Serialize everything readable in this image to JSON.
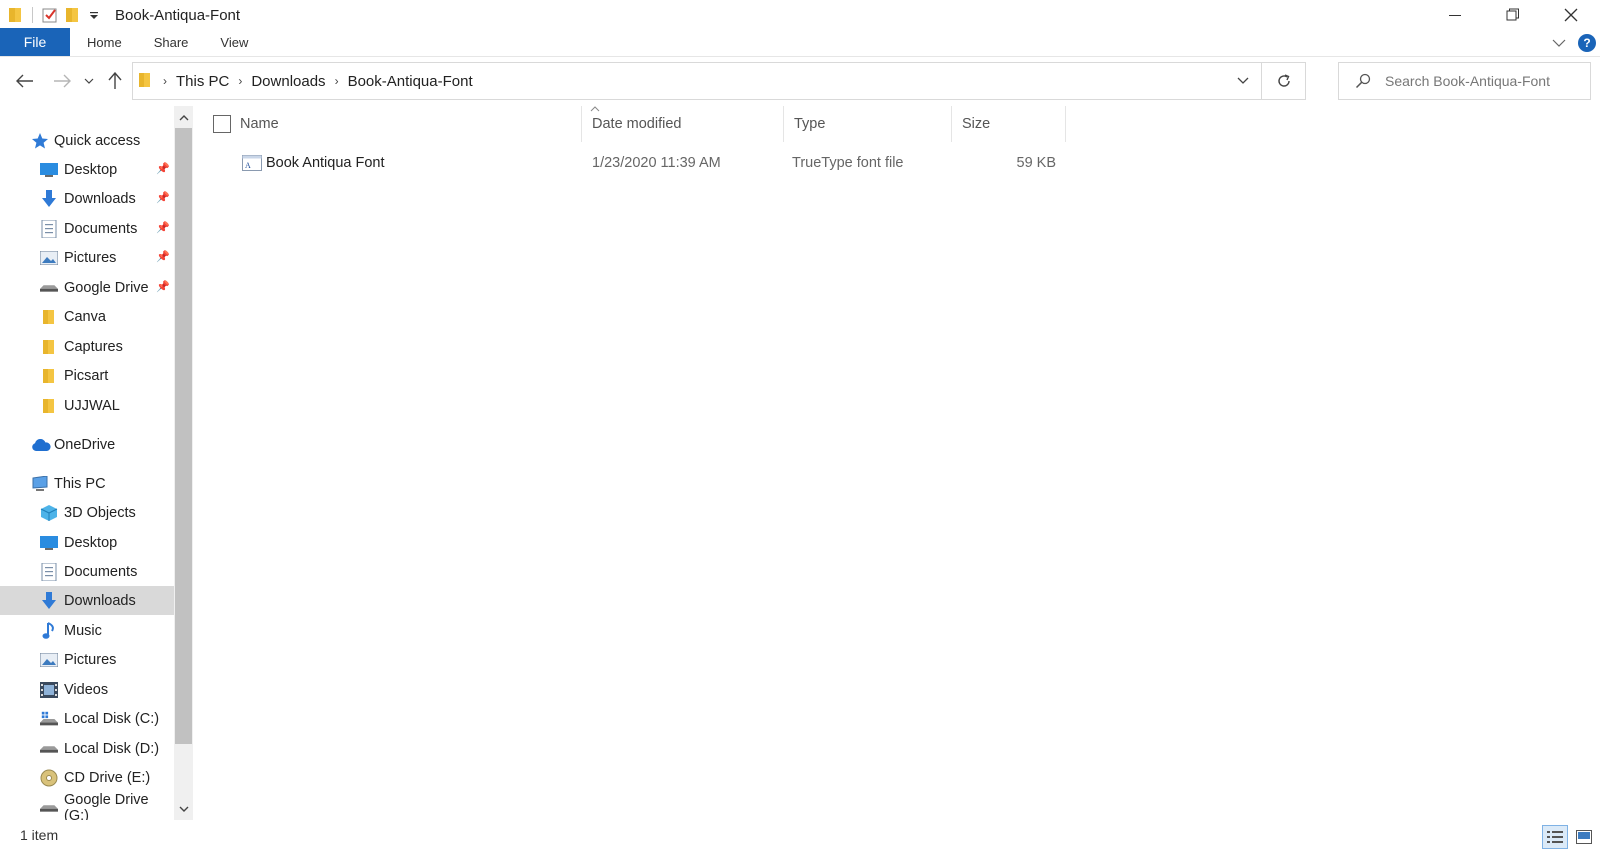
{
  "window": {
    "title": "Book-Antiqua-Font",
    "minimize_icon": "minimize-icon",
    "maximize_icon": "restore-icon",
    "close_icon": "close-icon"
  },
  "ribbon": {
    "tabs": [
      {
        "label": "File"
      },
      {
        "label": "Home"
      },
      {
        "label": "Share"
      },
      {
        "label": "View"
      }
    ],
    "accent_color": "#1a64b8",
    "help_label": "?"
  },
  "navigation": {
    "breadcrumb": [
      "This PC",
      "Downloads",
      "Book-Antiqua-Font"
    ],
    "search_placeholder": "Search Book-Antiqua-Font"
  },
  "sidebar": {
    "quick_access": {
      "label": "Quick access"
    },
    "quick_access_items": [
      {
        "label": "Desktop",
        "icon": "desktop-icon",
        "pinned": true
      },
      {
        "label": "Downloads",
        "icon": "download-icon",
        "pinned": true
      },
      {
        "label": "Documents",
        "icon": "documents-icon",
        "pinned": true
      },
      {
        "label": "Pictures",
        "icon": "pictures-icon",
        "pinned": true
      },
      {
        "label": "Google Drive",
        "icon": "drive-icon",
        "pinned": true
      },
      {
        "label": "Canva",
        "icon": "folder-icon",
        "pinned": false
      },
      {
        "label": "Captures",
        "icon": "folder-icon",
        "pinned": false
      },
      {
        "label": "Picsart",
        "icon": "folder-icon",
        "pinned": false
      },
      {
        "label": "UJJWAL",
        "icon": "folder-icon",
        "pinned": false
      }
    ],
    "onedrive": {
      "label": "OneDrive"
    },
    "this_pc": {
      "label": "This PC"
    },
    "this_pc_items": [
      {
        "label": "3D Objects",
        "icon": "3d-objects-icon"
      },
      {
        "label": "Desktop",
        "icon": "desktop-icon"
      },
      {
        "label": "Documents",
        "icon": "documents-icon"
      },
      {
        "label": "Downloads",
        "icon": "download-icon",
        "selected": true
      },
      {
        "label": "Music",
        "icon": "music-icon"
      },
      {
        "label": "Pictures",
        "icon": "pictures-icon"
      },
      {
        "label": "Videos",
        "icon": "videos-icon"
      },
      {
        "label": "Local Disk (C:)",
        "icon": "drive-icon"
      },
      {
        "label": "Local Disk (D:)",
        "icon": "drive-icon"
      },
      {
        "label": "CD Drive (E:)",
        "icon": "cd-drive-icon"
      },
      {
        "label": "Google Drive (G:)",
        "icon": "drive-icon"
      }
    ]
  },
  "file_list": {
    "columns": {
      "name": "Name",
      "date": "Date modified",
      "type": "Type",
      "size": "Size"
    },
    "rows": [
      {
        "name": "Book Antiqua Font",
        "date": "1/23/2020 11:39 AM",
        "type": "TrueType font file",
        "size": "59 KB",
        "icon": "font-file-icon"
      }
    ]
  },
  "status_bar": {
    "item_count": "1 item"
  }
}
